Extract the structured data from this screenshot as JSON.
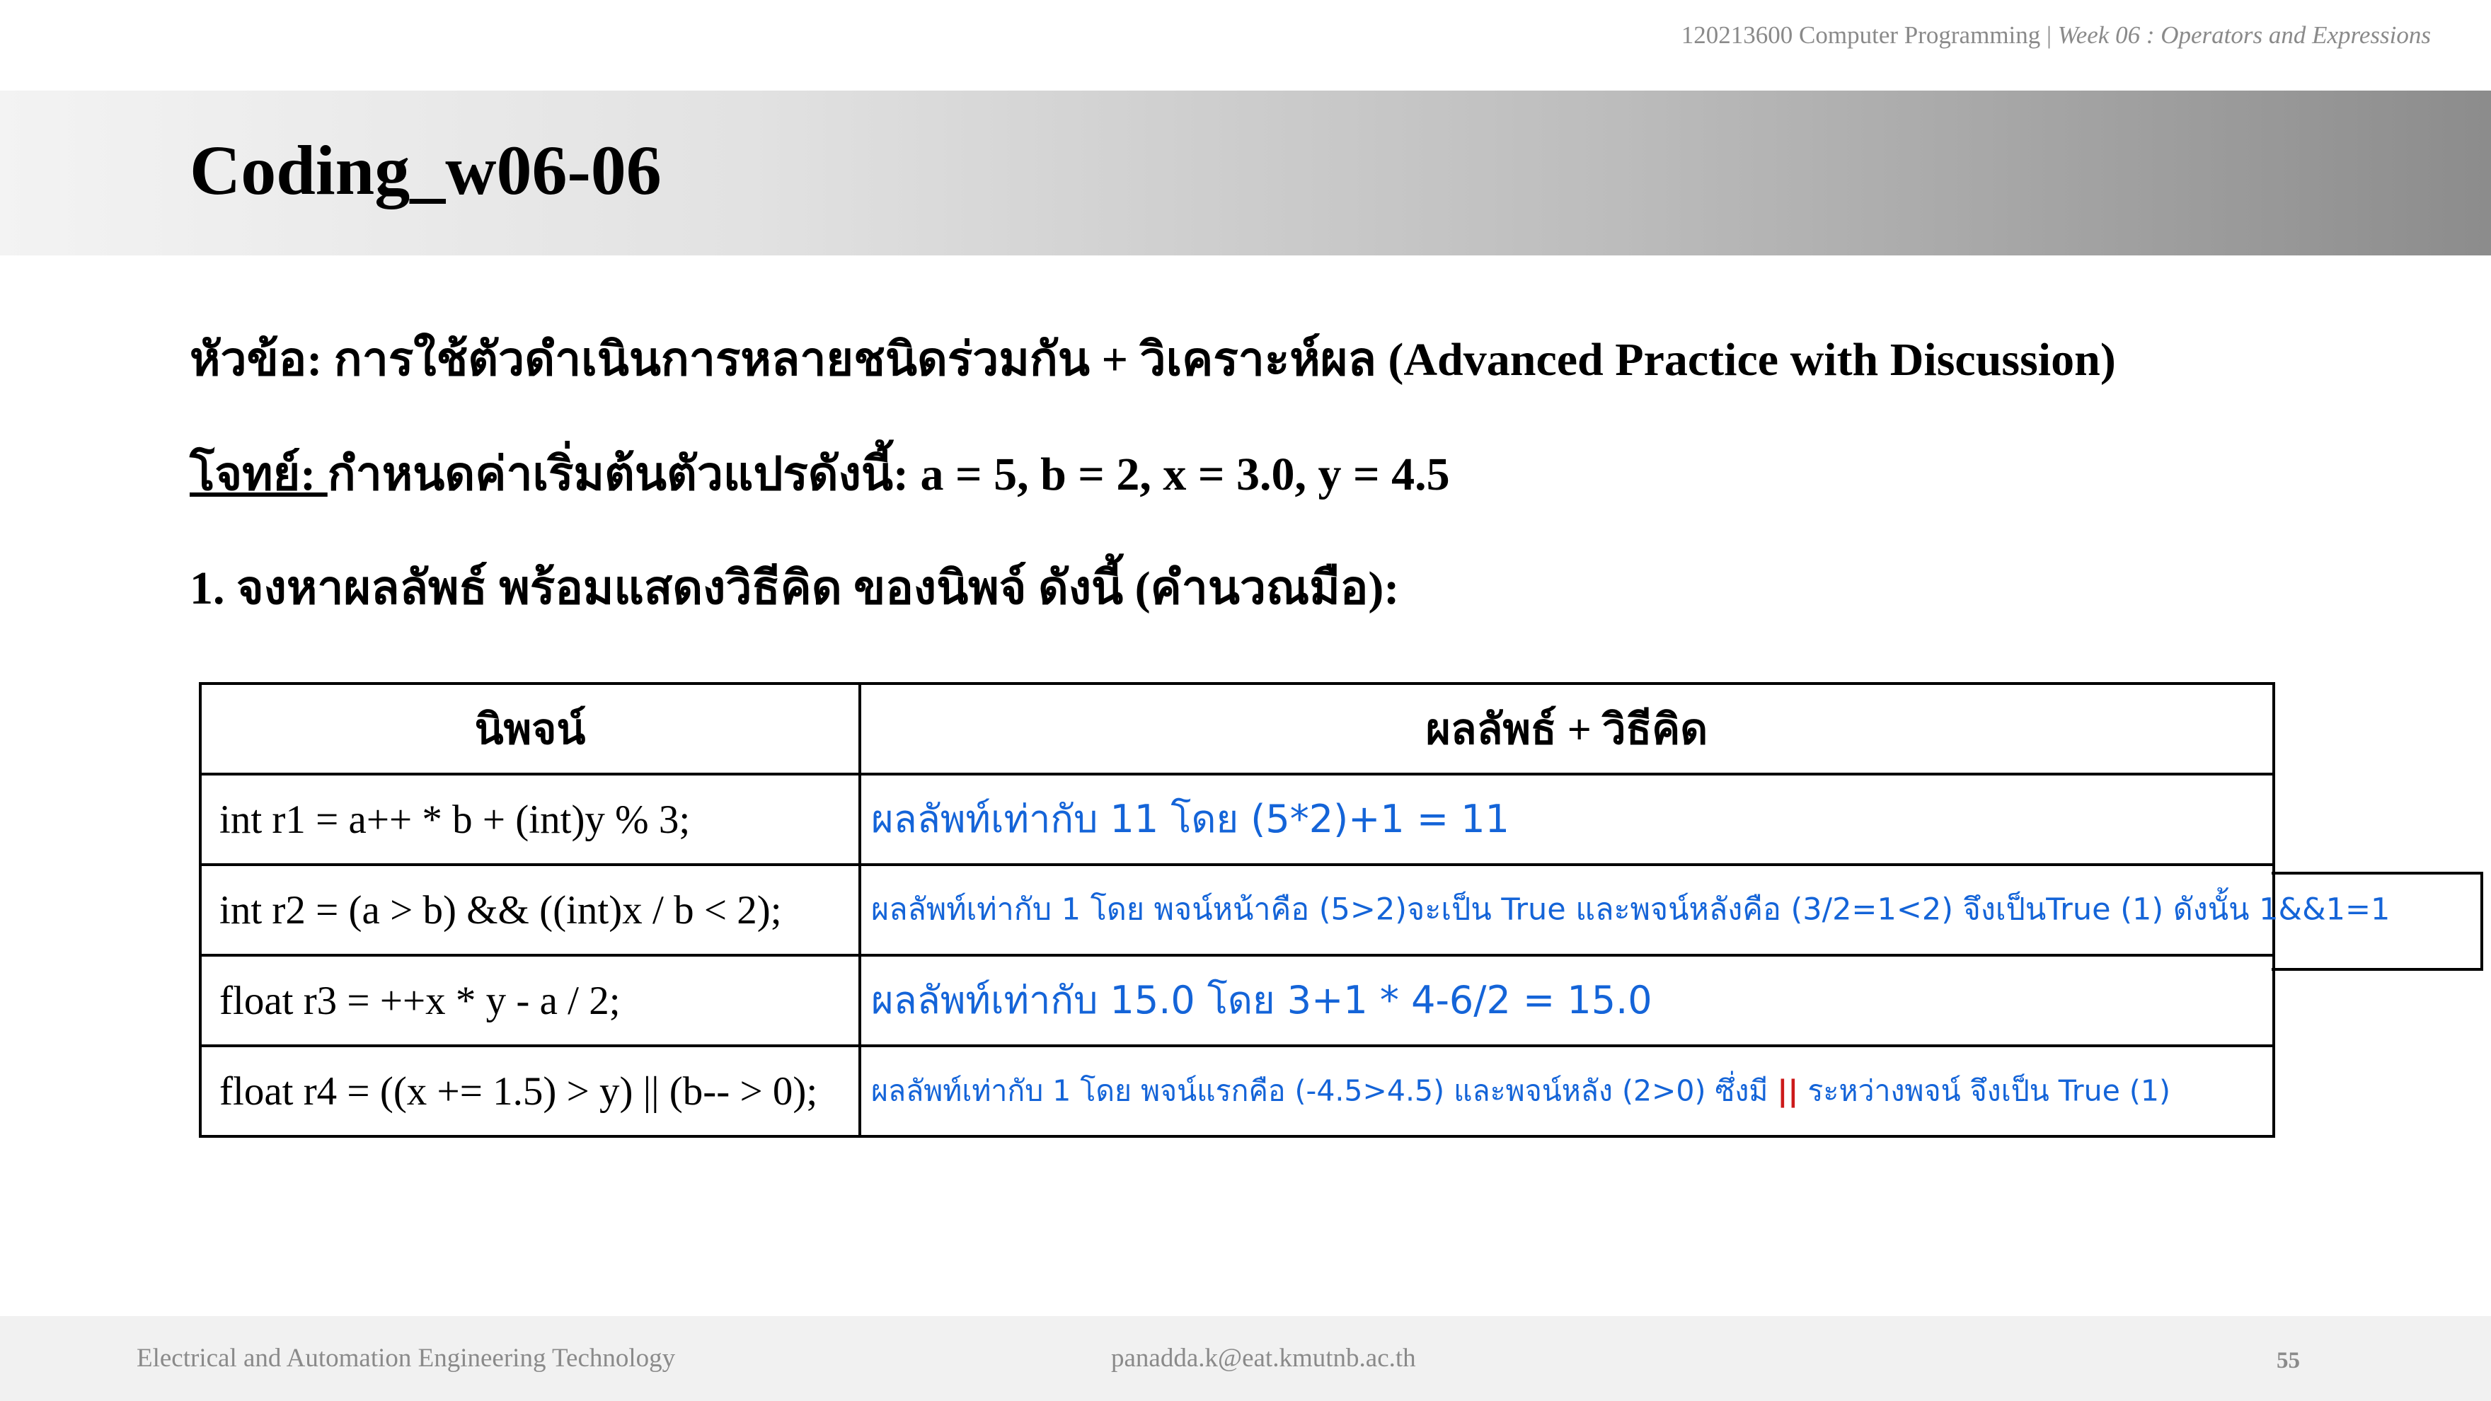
{
  "header": {
    "course": "120213600 Computer Programming",
    "separator": " | ",
    "week": "Week 06 : Operators and Expressions"
  },
  "slide_title": "Coding_w06-06",
  "topic": "หัวข้อ: การใช้ตัวดำเนินการหลายชนิดร่วมกัน + วิเคราะห์ผล (Advanced Practice with Discussion)",
  "problem": {
    "label": "โจทย์: ",
    "text": "กำหนดค่าเริ่มต้นตัวแปรดังนี้: a = 5, b = 2, x = 3.0, y = 4.5"
  },
  "instruction": "1. จงหาผลลัพธ์ พร้อมแสดงวิธีคิด ของนิพจ์ ดังนี้ (คำนวณมือ):",
  "table": {
    "headers": [
      "นิพจน์",
      "ผลลัพธ์ + วิธีคิด"
    ],
    "rows": [
      {
        "expression": "int r1 = a++ * b + (int)y % 3;",
        "answer": "ผลลัพท์เท่ากับ 11 โดย (5*2)+1 = 11"
      },
      {
        "expression": "int r2 = (a > b) && ((int)x / b < 2);",
        "answer": "ผลลัพท์เท่ากับ 1 โดย พจน์หน้าคือ (5>2)จะเป็น True และพจน์หลังคือ (3/2=1<2) จึงเป็นTrue (1) ดังนั้น 1&&1=1"
      },
      {
        "expression": "float r3 = ++x * y - a / 2;",
        "answer": "ผลลัพท์เท่ากับ 15.0 โดย 3+1 * 4-6/2 = 15.0"
      },
      {
        "expression": "float r4 = ((x += 1.5) > y) || (b-- > 0);",
        "answer_before": "ผลลัพท์เท่ากับ 1 โดย พจน์แรกคือ (-4.5>4.5) และพจน์หลัง (2>0) ซึ่งมี ",
        "answer_mark": "||",
        "answer_after": " ระหว่างพจน์ จึงเป็น True (1)"
      }
    ]
  },
  "footer": {
    "left": "Electrical and Automation Engineering Technology",
    "center": "panadda.k@eat.kmutnb.ac.th",
    "page": "55"
  },
  "colors": {
    "handwriting": "#1464d8",
    "handwriting_mark": "#cc1a1a",
    "muted_text": "#8a8a8a"
  }
}
